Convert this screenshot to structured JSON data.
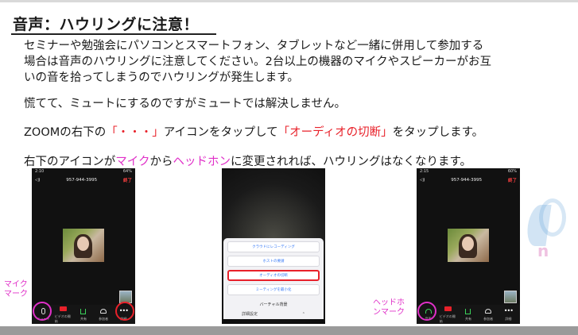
{
  "heading": "音声：ハウリングに注意！",
  "paragraphs": {
    "p1_line1": "セミナーや勉強会にパソコンとスマートフォン、タブレットなど一緒に併用して参加する",
    "p1_line2": "場合は音声のハウリングに注意してください。2台以上の機器のマイクやスピーカーがお互",
    "p1_line3": "いの音を拾ってしまうのでハウリングが発生します。",
    "p2": "慌てて、ミュートにするのですがミュートでは解決しません。",
    "p3_a": "ZOOMの右下の",
    "p3_b": "「・・・」",
    "p3_c": "アイコンをタップして",
    "p3_d": "「オーディオの切断」",
    "p3_e": "をタップします。",
    "p4_a": "右下のアイコンが",
    "p4_b": "マイク",
    "p4_c": "から",
    "p4_d": "ヘッドホン",
    "p4_e": "に変更されれば、ハウリングはなくなります。"
  },
  "labels": {
    "mic_line1": "マイク",
    "mic_line2": "マーク",
    "headphone_line1": "ヘッドホ",
    "headphone_line2": "ンマーク"
  },
  "phone_left": {
    "status_time": "2:10",
    "status_battery": "64%",
    "meeting_id": "957-944-3995",
    "end_label": "終了",
    "tools": [
      "ミュート",
      "ビデオの開始",
      "共有",
      "参加者",
      "詳細"
    ]
  },
  "phone_middle": {
    "menu_items": [
      "クラウドにレコーディング",
      "ホストの要請",
      "オーディオの切断",
      "ミーティングを最小化"
    ],
    "highlighted_item": "オーディオの切断",
    "virtual_bg": "バーチャル背景",
    "settings": "詳細設定",
    "chevron": "⌃"
  },
  "phone_right": {
    "status_time": "2:15",
    "status_battery": "60%",
    "meeting_id": "957-944-3995",
    "end_label": "終了",
    "tools": [
      "音声",
      "ビデオの開始",
      "共有",
      "参加者",
      "詳細"
    ]
  },
  "watermark_letter": "n",
  "colors": {
    "red": "#e8212a",
    "pink": "#e030c8",
    "bottom_bar": "#9a9a9a"
  }
}
